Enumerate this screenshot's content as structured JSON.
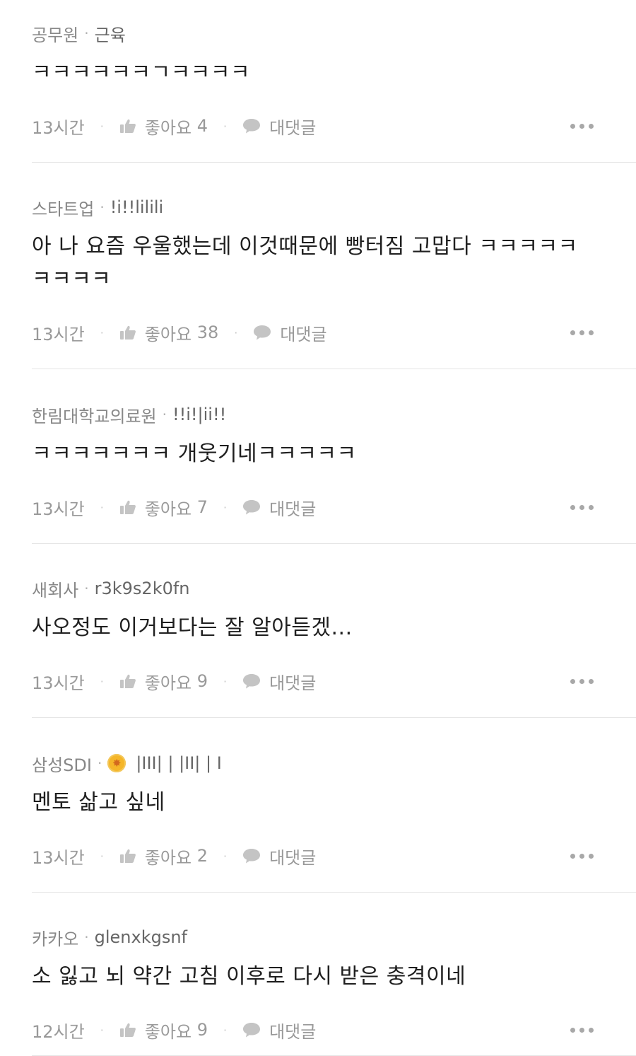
{
  "comments": [
    {
      "company": "공무원",
      "nickname": "근육",
      "text": "ㅋㅋㅋㅋㅋㅋㄱㅋㅋㅋㅋ",
      "time": "13시간",
      "likes_label": "좋아요",
      "likes": "4",
      "reply_label": "대댓글"
    },
    {
      "company": "스타트업",
      "nickname": "!i!!lilili",
      "text": "아 나 요즘 우울했는데 이것때문에 빵터짐 고맙다 ㅋㅋㅋㅋㅋ ㅋㅋㅋㅋ",
      "time": "13시간",
      "likes_label": "좋아요",
      "likes": "38",
      "reply_label": "대댓글"
    },
    {
      "company": "한림대학교의료원",
      "nickname": "!!i!|ii!!",
      "text": "ㅋㅋㅋㅋㅋㅋㅋ 개웃기네ㅋㅋㅋㅋㅋ",
      "time": "13시간",
      "likes_label": "좋아요",
      "likes": "7",
      "reply_label": "대댓글"
    },
    {
      "company": "새회사",
      "nickname": "r3k9s2k0fn",
      "text": "사오정도 이거보다는 잘 알아듣겠...",
      "time": "13시간",
      "likes_label": "좋아요",
      "likes": "9",
      "reply_label": "대댓글"
    },
    {
      "company": "삼성SDI",
      "nickname": "|III| | |II| | I",
      "badge_icon": "medal-badge-icon",
      "text": "멘토 삶고 싶네",
      "time": "13시간",
      "likes_label": "좋아요",
      "likes": "2",
      "reply_label": "대댓글"
    },
    {
      "company": "카카오",
      "nickname": "glenxkgsnf",
      "text": "소 잃고 뇌 약간 고침 이후로 다시 받은 충격이네",
      "time": "12시간",
      "likes_label": "좋아요",
      "likes": "9",
      "reply_label": "대댓글"
    }
  ],
  "separator": "·",
  "colors": {
    "background": "#ffffff",
    "meta_text": "#888888",
    "body_text": "#1f1f1f",
    "divider": "#e6e6e6",
    "badge": "#f5b629"
  }
}
